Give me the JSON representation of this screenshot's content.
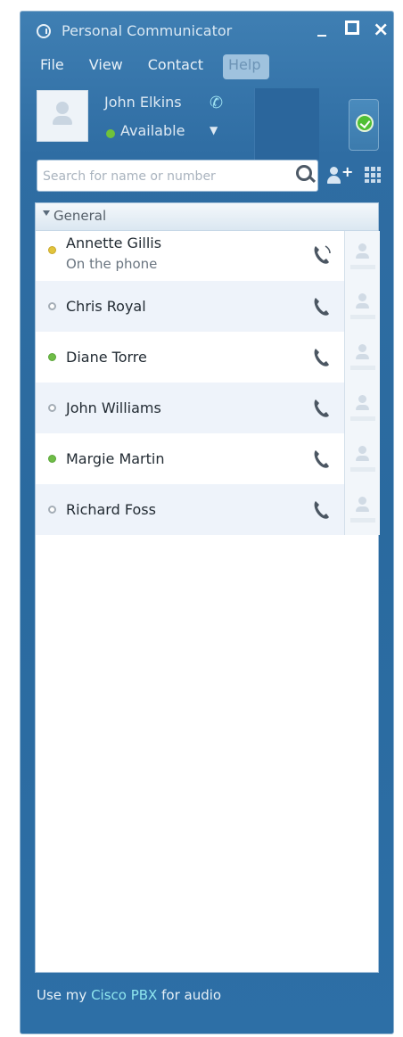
{
  "window": {
    "title": "Personal Communicator",
    "controls": {
      "minimize": "_",
      "close": "×"
    }
  },
  "menu": [
    "File",
    "View",
    "Contact",
    "Help"
  ],
  "user": {
    "name": "John Elkins",
    "status": "Available",
    "status_color": "#6fc23b"
  },
  "search": {
    "placeholder": "Search for name or number"
  },
  "group": {
    "name": "General"
  },
  "contacts": [
    {
      "name": "Annette Gillis",
      "status_text": "On the phone",
      "status": "busy",
      "icon": "phone-active-icon"
    },
    {
      "name": "Chris Royal",
      "status": "offline",
      "icon": "phone-icon"
    },
    {
      "name": "Diane Torre",
      "status": "available",
      "icon": "phone-icon"
    },
    {
      "name": "John Williams",
      "status": "offline",
      "icon": "phone-icon"
    },
    {
      "name": "Margie Martin",
      "status": "available",
      "icon": "phone-icon"
    },
    {
      "name": "Richard Foss",
      "status": "offline",
      "icon": "phone-icon"
    }
  ],
  "footer": {
    "prefix": "Use my",
    "link": "Cisco PBX",
    "suffix": "for audio"
  },
  "colors": {
    "window_blue": "#2a6a9f",
    "busy": "#e2c43c",
    "available": "#6fbd47",
    "offline": "#a4adb6",
    "link": "#8fe6ee"
  }
}
